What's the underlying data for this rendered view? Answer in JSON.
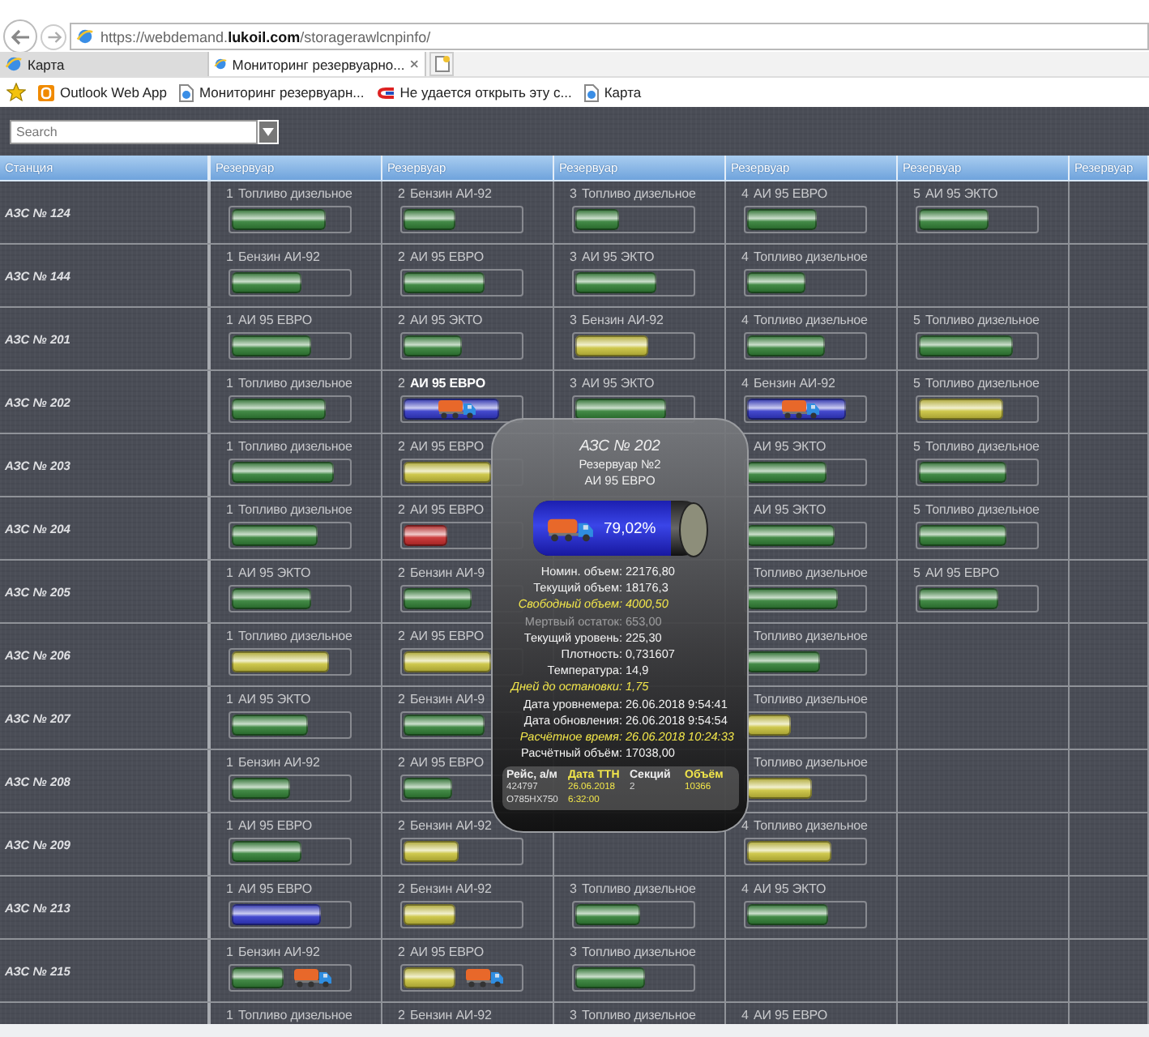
{
  "browser": {
    "url": "https://webdemand.**lukoil.com**/storagerawlcnpinfo/",
    "tabs": [
      {
        "label": "Карта",
        "selected": false
      },
      {
        "label": "Мониторинг резервуарно...",
        "selected": true
      }
    ],
    "favorites": [
      {
        "label": "Outlook Web App",
        "kind": "mail"
      },
      {
        "label": "Мониторинг резервуарн...",
        "kind": "page"
      },
      {
        "label": "Не удается открыть эту с...",
        "kind": "error"
      },
      {
        "label": "Карта",
        "kind": "page"
      }
    ]
  },
  "search": {
    "placeholder": "Search"
  },
  "columns": [
    "Станция",
    "Резервуар",
    "Резервуар",
    "Резервуар",
    "Резервуар",
    "Резервуар",
    "Резервуар"
  ],
  "stations": [
    {
      "name": "АЗС № 124",
      "cells": [
        {
          "num": "1",
          "fuel": "Топливо дизельное",
          "color": "#2e7d32",
          "level": 0.8,
          "truck": false,
          "selected": false
        },
        {
          "num": "2",
          "fuel": "Бензин АИ-92",
          "color": "#2e7d32",
          "level": 0.45,
          "truck": false,
          "selected": false
        },
        {
          "num": "3",
          "fuel": "Топливо дизельное",
          "color": "#2e7d32",
          "level": 0.38,
          "truck": false,
          "selected": false
        },
        {
          "num": "4",
          "fuel": "АИ 95 ЕВРО",
          "color": "#2e7d32",
          "level": 0.6,
          "truck": false,
          "selected": false
        },
        {
          "num": "5",
          "fuel": "АИ 95 ЭКТО",
          "color": "#2e7d32",
          "level": 0.6,
          "truck": false,
          "selected": false
        }
      ]
    },
    {
      "name": "АЗС № 144",
      "cells": [
        {
          "num": "1",
          "fuel": "Бензин АИ-92",
          "color": "#2e7d32",
          "level": 0.6,
          "truck": false,
          "selected": false
        },
        {
          "num": "2",
          "fuel": "АИ 95 ЕВРО",
          "color": "#2e7d32",
          "level": 0.7,
          "truck": false,
          "selected": false
        },
        {
          "num": "3",
          "fuel": "АИ 95 ЭКТО",
          "color": "#2e7d32",
          "level": 0.7,
          "truck": false,
          "selected": false
        },
        {
          "num": "4",
          "fuel": "Топливо дизельное",
          "color": "#2e7d32",
          "level": 0.5,
          "truck": false,
          "selected": false
        },
        null
      ]
    },
    {
      "name": "АЗС № 201",
      "cells": [
        {
          "num": "1",
          "fuel": "АИ 95 ЕВРО",
          "color": "#2e7d32",
          "level": 0.68,
          "truck": false,
          "selected": false
        },
        {
          "num": "2",
          "fuel": "АИ 95 ЭКТО",
          "color": "#2e7d32",
          "level": 0.5,
          "truck": false,
          "selected": false
        },
        {
          "num": "3",
          "fuel": "Бензин АИ-92",
          "color": "#c9c23a",
          "level": 0.63,
          "truck": false,
          "selected": false
        },
        {
          "num": "4",
          "fuel": "Топливо дизельное",
          "color": "#2e7d32",
          "level": 0.66,
          "truck": false,
          "selected": false
        },
        {
          "num": "5",
          "fuel": "Топливо дизельное",
          "color": "#2e7d32",
          "level": 0.8,
          "truck": false,
          "selected": false
        }
      ]
    },
    {
      "name": "АЗС № 202",
      "cells": [
        {
          "num": "1",
          "fuel": "Топливо дизельное",
          "color": "#2e7d32",
          "level": 0.8,
          "truck": false,
          "selected": false
        },
        {
          "num": "2",
          "fuel": "АИ 95 ЕВРО",
          "color": "#2f35c8",
          "level": 0.82,
          "truck": true,
          "selected": true
        },
        {
          "num": "3",
          "fuel": "АИ 95 ЭКТО",
          "color": "#2e7d32",
          "level": 0.78,
          "truck": false,
          "selected": false
        },
        {
          "num": "4",
          "fuel": "Бензин АИ-92",
          "color": "#2f35c8",
          "level": 0.85,
          "truck": true,
          "selected": false
        },
        {
          "num": "5",
          "fuel": "Топливо дизельное",
          "color": "#c9c23a",
          "level": 0.72,
          "truck": false,
          "selected": false
        }
      ]
    },
    {
      "name": "АЗС № 203",
      "cells": [
        {
          "num": "1",
          "fuel": "Топливо дизельное",
          "color": "#2e7d32",
          "level": 0.87,
          "truck": false,
          "selected": false
        },
        {
          "num": "2",
          "fuel": "АИ 95 ЕВРО",
          "color": "#c9c23a",
          "level": 0.75,
          "truck": false,
          "selected": false
        },
        null,
        {
          "fuel": "АИ 95 ЭКТО",
          "color": "#2e7d32",
          "level": 0.68,
          "truck": false,
          "selected": false
        },
        {
          "num": "5",
          "fuel": "Топливо дизельное",
          "color": "#2e7d32",
          "level": 0.75,
          "truck": false,
          "selected": false
        }
      ]
    },
    {
      "name": "АЗС № 204",
      "cells": [
        {
          "num": "1",
          "fuel": "Топливо дизельное",
          "color": "#2e7d32",
          "level": 0.73,
          "truck": false,
          "selected": false
        },
        {
          "num": "2",
          "fuel": "АИ 95 ЕВРО",
          "color": "#c62828",
          "level": 0.37,
          "truck": false,
          "selected": false
        },
        null,
        {
          "fuel": "АИ 95 ЭКТО",
          "color": "#2e7d32",
          "level": 0.75,
          "truck": false,
          "selected": false
        },
        {
          "num": "5",
          "fuel": "Топливо дизельное",
          "color": "#2e7d32",
          "level": 0.75,
          "truck": false,
          "selected": false
        }
      ]
    },
    {
      "name": "АЗС № 205",
      "cells": [
        {
          "num": "1",
          "fuel": "АИ 95 ЭКТО",
          "color": "#2e7d32",
          "level": 0.68,
          "truck": false,
          "selected": false
        },
        {
          "num": "2",
          "fuel": "Бензин АИ-9",
          "color": "#2e7d32",
          "level": 0.58,
          "truck": false,
          "selected": false
        },
        null,
        {
          "fuel": "Топливо дизельное",
          "color": "#2e7d32",
          "level": 0.78,
          "truck": false,
          "selected": false
        },
        {
          "num": "5",
          "fuel": "АИ 95 ЕВРО",
          "color": "#2e7d32",
          "level": 0.68,
          "truck": false,
          "selected": false
        }
      ]
    },
    {
      "name": "АЗС № 206",
      "cells": [
        {
          "num": "1",
          "fuel": "Топливо дизельное",
          "color": "#c9c23a",
          "level": 0.83,
          "truck": false,
          "selected": false
        },
        {
          "num": "2",
          "fuel": "АИ 95 ЕВРО",
          "color": "#c9c23a",
          "level": 0.75,
          "truck": false,
          "selected": false
        },
        null,
        {
          "fuel": "Топливо дизельное",
          "color": "#2e7d32",
          "level": 0.62,
          "truck": false,
          "selected": false
        },
        null
      ]
    },
    {
      "name": "АЗС № 207",
      "cells": [
        {
          "num": "1",
          "fuel": "АИ 95 ЭКТО",
          "color": "#2e7d32",
          "level": 0.65,
          "truck": false,
          "selected": false
        },
        {
          "num": "2",
          "fuel": "Бензин АИ-9",
          "color": "#2e7d32",
          "level": 0.7,
          "truck": false,
          "selected": false
        },
        null,
        {
          "fuel": "Топливо дизельное",
          "color": "#c9c23a",
          "level": 0.38,
          "truck": false,
          "selected": false
        },
        null
      ]
    },
    {
      "name": "АЗС № 208",
      "cells": [
        {
          "num": "1",
          "fuel": "Бензин АИ-92",
          "color": "#2e7d32",
          "level": 0.5,
          "truck": false,
          "selected": false
        },
        {
          "num": "2",
          "fuel": "АИ 95 ЕВРО",
          "color": "#2e7d32",
          "level": 0.42,
          "truck": false,
          "selected": false
        },
        null,
        {
          "fuel": "Топливо дизельное",
          "color": "#c9c23a",
          "level": 0.55,
          "truck": false,
          "selected": false
        },
        null
      ]
    },
    {
      "name": "АЗС № 209",
      "cells": [
        {
          "num": "1",
          "fuel": "АИ 95 ЕВРО",
          "color": "#2e7d32",
          "level": 0.6,
          "truck": false,
          "selected": false
        },
        {
          "num": "2",
          "fuel": "Бензин АИ-92",
          "color": "#c9c23a",
          "level": 0.47,
          "truck": false,
          "selected": false
        },
        null,
        {
          "num": "4",
          "fuel": "Топливо дизельное",
          "color": "#c9c23a",
          "level": 0.72,
          "truck": false,
          "selected": false
        },
        null
      ]
    },
    {
      "name": "АЗС № 213",
      "cells": [
        {
          "num": "1",
          "fuel": "АИ 95 ЕВРО",
          "color": "#2f35c8",
          "level": 0.76,
          "truck": false,
          "selected": false
        },
        {
          "num": "2",
          "fuel": "Бензин АИ-92",
          "color": "#c9c23a",
          "level": 0.45,
          "truck": false,
          "selected": false
        },
        {
          "num": "3",
          "fuel": "Топливо дизельное",
          "color": "#2e7d32",
          "level": 0.55,
          "truck": false,
          "selected": false
        },
        {
          "num": "4",
          "fuel": "АИ 95 ЭКТО",
          "color": "#2e7d32",
          "level": 0.7,
          "truck": false,
          "selected": false
        },
        null
      ]
    },
    {
      "name": "АЗС № 215",
      "cells": [
        {
          "num": "1",
          "fuel": "Бензин АИ-92",
          "color": "#2e7d32",
          "level": 0.45,
          "truck": true,
          "selected": false
        },
        {
          "num": "2",
          "fuel": "АИ 95 ЕВРО",
          "color": "#c9c23a",
          "level": 0.45,
          "truck": true,
          "selected": false
        },
        {
          "num": "3",
          "fuel": "Топливо дизельное",
          "color": "#2e7d32",
          "level": 0.6,
          "truck": false,
          "selected": false
        },
        null,
        null
      ]
    },
    {
      "cells": [
        {
          "num": "1",
          "fuel": "Топливо дизельное",
          "selected": false
        },
        {
          "num": "2",
          "fuel": "Бензин АИ-92",
          "selected": false
        },
        {
          "num": "3",
          "fuel": "Топливо дизельное",
          "selected": false
        },
        {
          "num": "4",
          "fuel": "АИ 95 ЕВРО",
          "selected": false
        },
        null
      ]
    }
  ],
  "popup": {
    "title": "АЗС № 202",
    "subtitle": "Резервуар №2",
    "product": "АИ 95 ЕВРО",
    "level": 0.7902,
    "percent": "79,02%",
    "truck": true,
    "fields": [
      {
        "label": "Номин. объем:",
        "value": "22176,80",
        "warning": false,
        "disabled": false
      },
      {
        "label": "Текущий объем:",
        "value": "18176,3",
        "warning": false,
        "disabled": false
      },
      {
        "label": "Свободный объем:",
        "value": "4000,50",
        "warning": true,
        "disabled": false
      },
      {
        "label": "Мертвый остаток:",
        "value": "653,00",
        "warning": false,
        "disabled": true
      },
      {
        "label": "Текущий уровень:",
        "value": "225,30",
        "warning": false,
        "disabled": false
      },
      {
        "label": "Плотность:",
        "value": "0,731607",
        "warning": false,
        "disabled": false
      },
      {
        "label": "Температура:",
        "value": "14,9",
        "warning": false,
        "disabled": false
      },
      {
        "label": "Дней до остановки:",
        "value": "1,75",
        "warning": true,
        "disabled": false
      },
      {
        "label": "Дата уровнемера:",
        "value": "26.06.2018 9:54:41",
        "warning": false,
        "disabled": false
      },
      {
        "label": "Дата обновления:",
        "value": "26.06.2018 9:54:54",
        "warning": false,
        "disabled": false
      },
      {
        "label": "Расчётное время:",
        "value": "26.06.2018 10:24:33",
        "warning": true,
        "disabled": false
      },
      {
        "label": "Расчётный объём:",
        "value": "17038,00",
        "warning": false,
        "disabled": false
      }
    ],
    "trips": {
      "columns": [
        {
          "label": "Рейс, а/м",
          "highlight": false
        },
        {
          "label": "Дата ТТН",
          "highlight": true
        },
        {
          "label": "Секций",
          "highlight": false
        },
        {
          "label": "Объём",
          "highlight": true
        }
      ],
      "rows": [
        [
          "424797",
          "26.06.2018",
          "2",
          "10366"
        ],
        [
          "О785НХ750",
          "6:32:00"
        ]
      ]
    }
  }
}
